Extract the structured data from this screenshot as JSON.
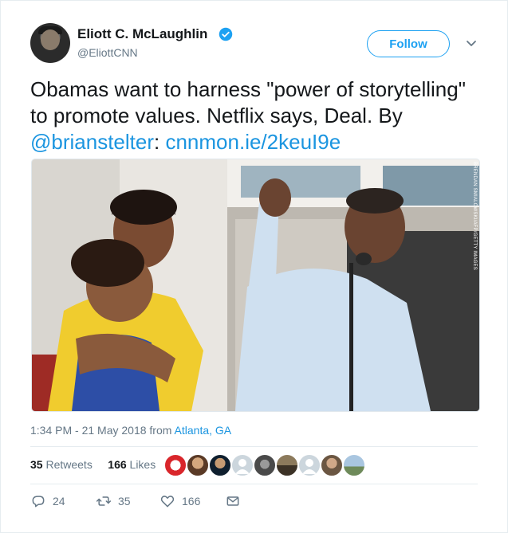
{
  "author": {
    "name": "Eliott C. McLaughlin",
    "handle": "@EliottCNN",
    "verified": true
  },
  "follow_button": {
    "label": "Follow"
  },
  "tweet": {
    "text_main": "Obamas want to harness \"power of storytelling\" to promote values. Netflix says, Deal. By ",
    "mention": "@brianstelter",
    "separator": ": ",
    "link": "cnnmon.ie/2keuI9e"
  },
  "media": {
    "photo_credit": "BRENDAN SMIALOWSKI/AFP/GETTY IMAGES"
  },
  "meta": {
    "timestamp": "1:34 PM - 21 May 2018",
    "from_label": " from ",
    "location": "Atlanta, GA"
  },
  "stats": {
    "retweets_count": "35",
    "retweets_label": " Retweets",
    "likes_count": "166",
    "likes_label": " Likes"
  },
  "actions": {
    "replies": "24",
    "retweets": "35",
    "likes": "166"
  },
  "colors": {
    "accent": "#1da1f2",
    "link": "#1b95e0",
    "muted": "#657786"
  }
}
